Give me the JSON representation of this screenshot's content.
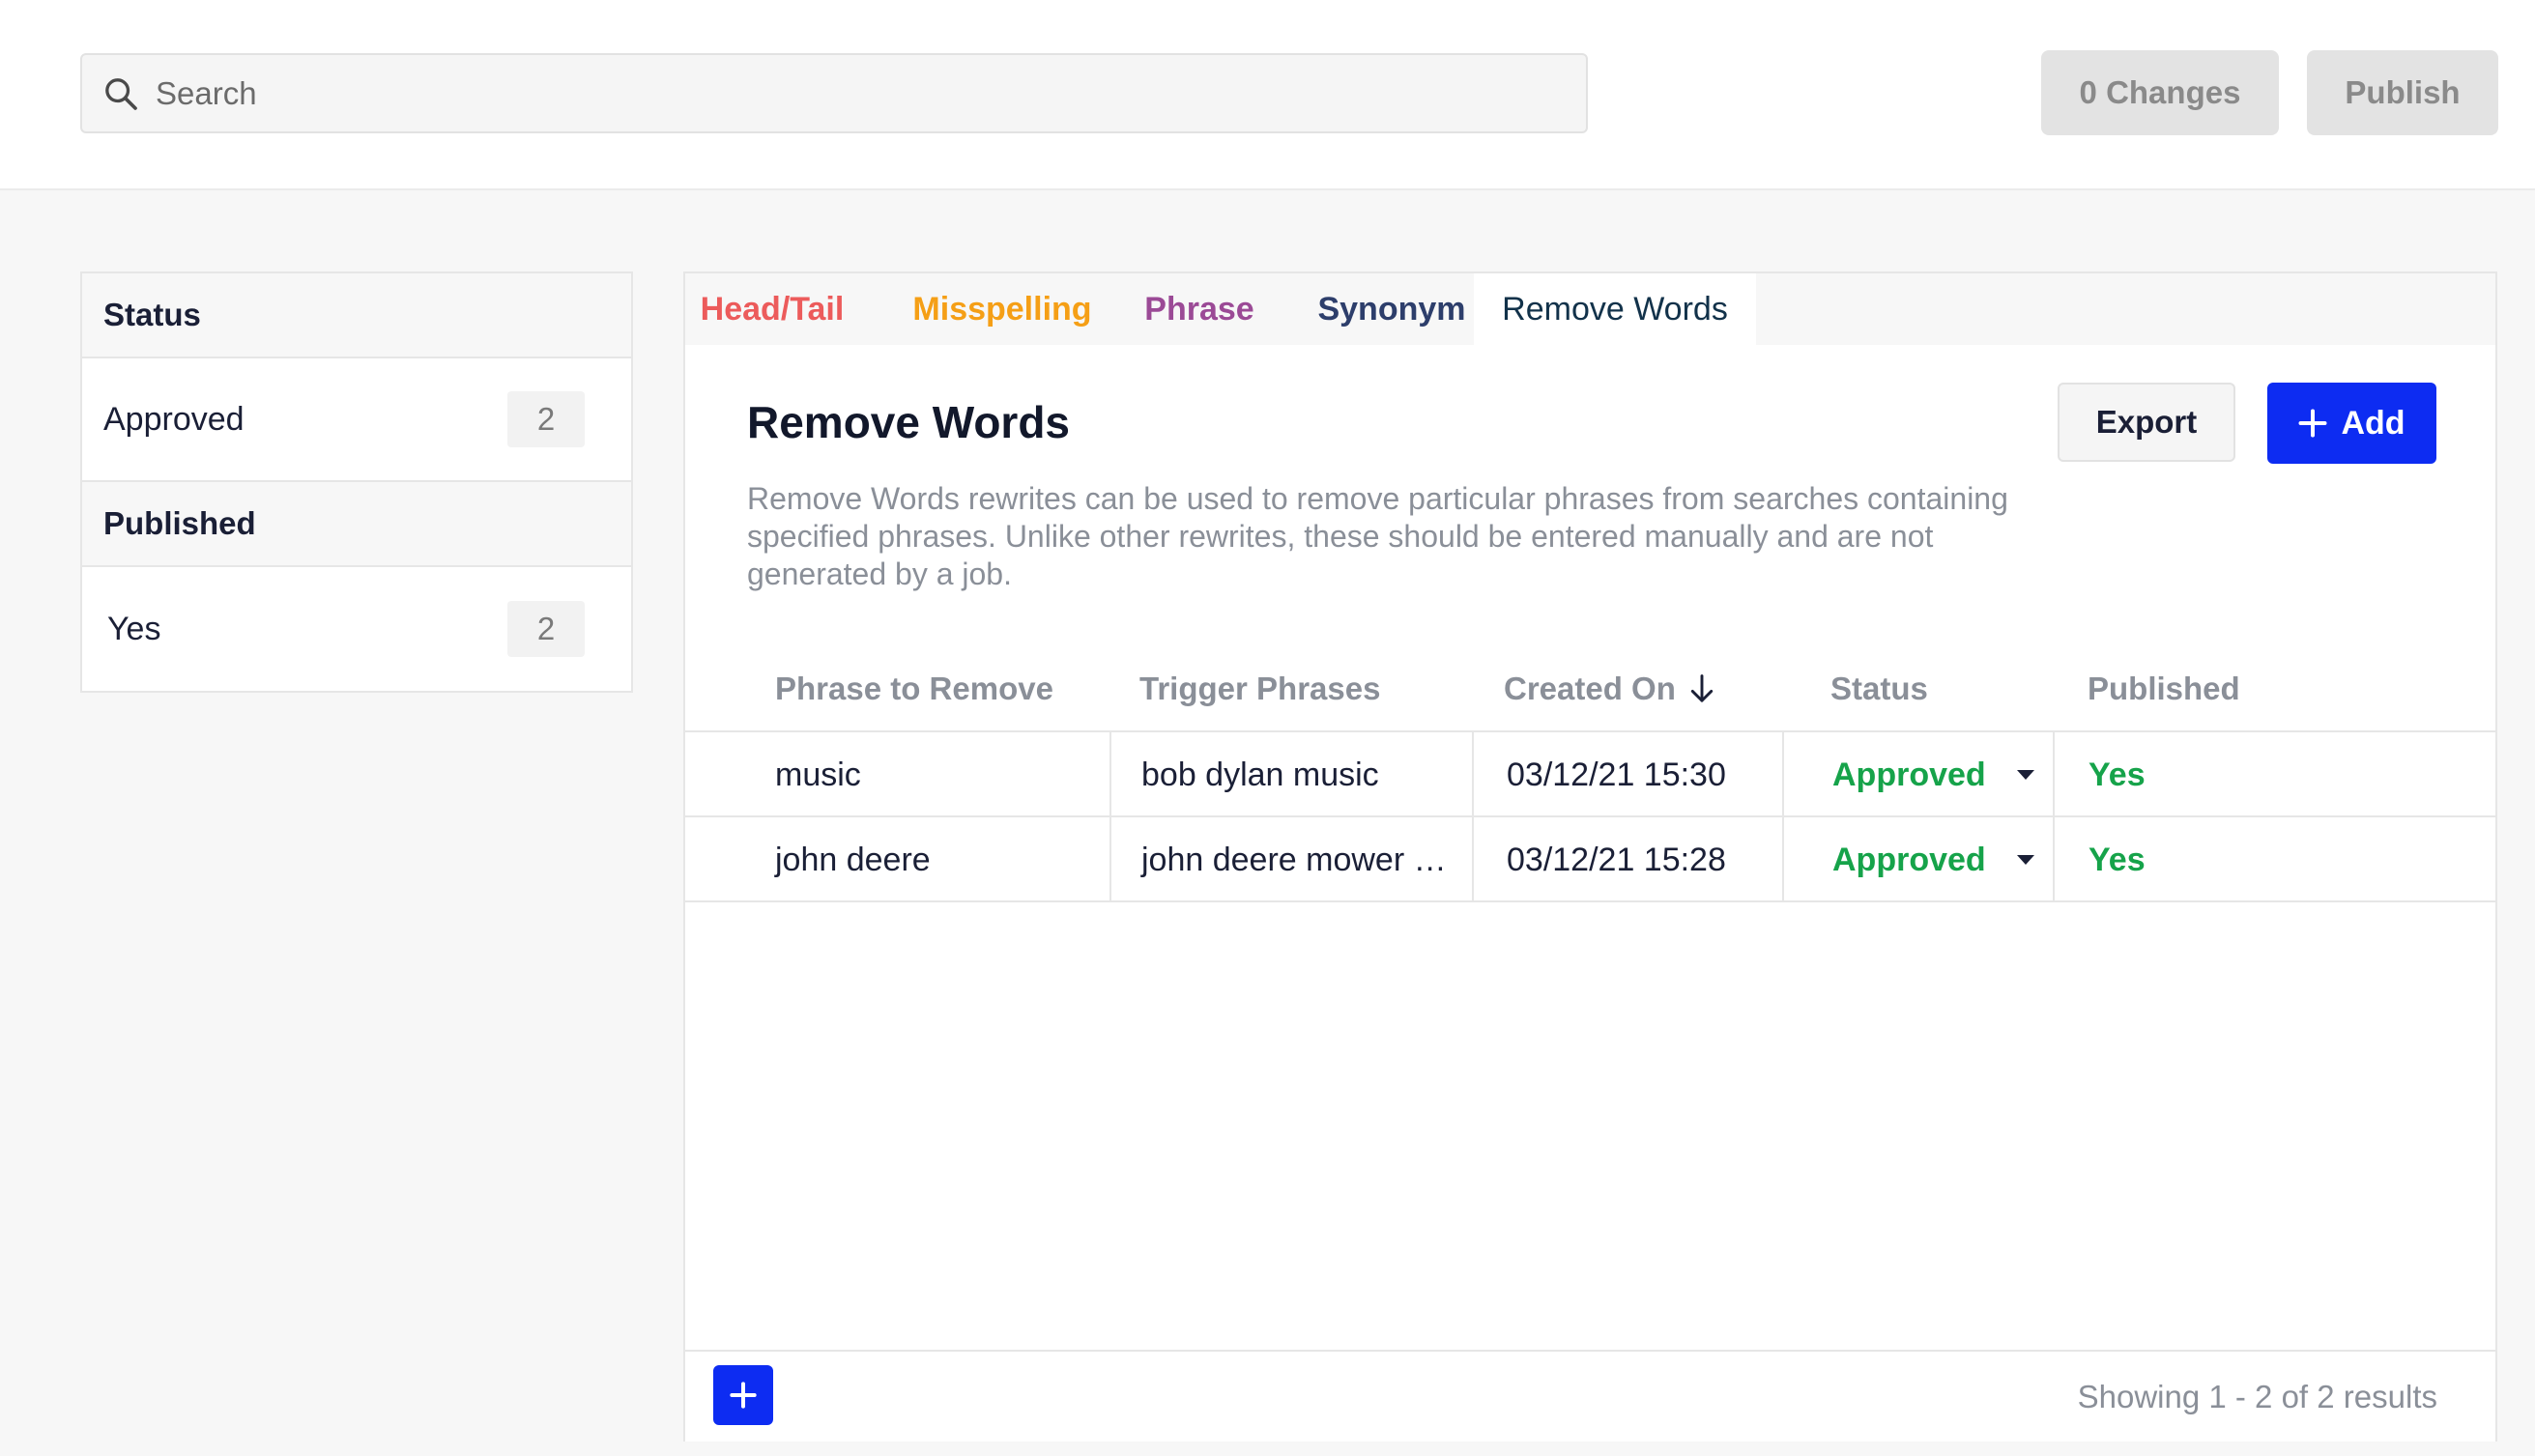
{
  "search": {
    "placeholder": "Search",
    "icon": "search-icon"
  },
  "header": {
    "changes_label": "0 Changes",
    "publish_label": "Publish"
  },
  "sidebar": {
    "sections": [
      {
        "title": "Status",
        "items": [
          {
            "label": "Approved",
            "count": "2"
          }
        ]
      },
      {
        "title": "Published",
        "items": [
          {
            "label": "Yes",
            "count": "2"
          }
        ]
      }
    ]
  },
  "tabs": [
    {
      "label": "Head/Tail",
      "color": "#ec5b5b"
    },
    {
      "label": "Misspelling",
      "color": "#f59f16"
    },
    {
      "label": "Phrase",
      "color": "#9b4a96"
    },
    {
      "label": "Synonym",
      "color": "#2d3e6b"
    },
    {
      "label": "Remove Words",
      "color": "#12324a",
      "active": true
    }
  ],
  "main": {
    "title": "Remove Words",
    "description": "Remove Words rewrites can be used to remove particular phrases from searches containing specified phrases. Unlike other rewrites, these should be entered manually and are not generated by a job.",
    "export_label": "Export",
    "add_label": "Add"
  },
  "table": {
    "columns": [
      "Phrase to Remove",
      "Trigger Phrases",
      "Created On",
      "Status",
      "Published"
    ],
    "sort_icon": "arrow-down-icon",
    "rows": [
      {
        "phrase": "music",
        "trigger": "bob dylan music",
        "created": "03/12/21 15:30",
        "status": "Approved",
        "published": "Yes"
      },
      {
        "phrase": "john deere",
        "trigger": "john deere mower …",
        "created": "03/12/21 15:28",
        "status": "Approved",
        "published": "Yes"
      }
    ]
  },
  "footer": {
    "results_text": "Showing 1 - 2 of 2 results"
  },
  "colors": {
    "accent": "#0d2cf2",
    "success": "#16a34a"
  }
}
